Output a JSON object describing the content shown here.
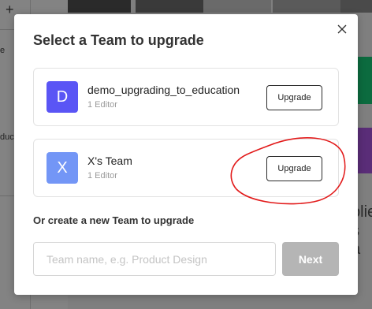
{
  "background": {
    "sidebar_snippets": [
      "e",
      "duc"
    ],
    "right_snippets": [
      "plie",
      "s a"
    ],
    "colors": {
      "green": "#0c6b3f",
      "purple": "#5a2d78"
    }
  },
  "modal": {
    "title": "Select a Team to upgrade",
    "close_icon": "close-icon",
    "teams": [
      {
        "initial": "D",
        "name": "demo_upgrading_to_education",
        "subtitle": "1 Editor",
        "button": "Upgrade",
        "avatar_color": "#5a55f5"
      },
      {
        "initial": "X",
        "name": "X's Team",
        "subtitle": "1 Editor",
        "button": "Upgrade",
        "avatar_color": "#7396f6"
      }
    ],
    "create_label": "Or create a new Team to upgrade",
    "input": {
      "value": "",
      "placeholder": "Team name, e.g. Product Design"
    },
    "next_button": "Next",
    "next_button_color": "#b5b5b5"
  }
}
